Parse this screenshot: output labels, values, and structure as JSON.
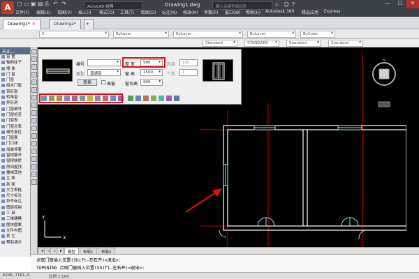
{
  "titlebar": {
    "app_icon": "A",
    "workspace": "AutoCAD 经典",
    "title": "Drawing1.dwg",
    "search_placeholder": "键入关键字或短语",
    "menu": [
      "文件(F)",
      "编辑(E)",
      "视图(V)",
      "插入(I)",
      "格式(O)",
      "工具(T)",
      "绘图(D)",
      "标注(N)",
      "修改(M)",
      "参数(P)",
      "窗口(W)",
      "帮助(H)",
      "Autodesk 360",
      "精选应用",
      "Express"
    ],
    "min": "—",
    "max": "☐",
    "close": "✕"
  },
  "doc_tabs": [
    {
      "label": "Drawing1*",
      "active": true
    },
    {
      "label": "Drawing2*",
      "active": false
    }
  ],
  "props": {
    "layer": "0",
    "color": "ByLayer",
    "linetype": "ByLayer",
    "lineweight": "ByLayer",
    "plotstyle": "ByColor",
    "textstyle": "Standard",
    "dimstyle": "STANDARD",
    "tablestyle": "Standard",
    "mleaderstyle": "Standard",
    "row2_workspace": "AutoCAD 经典"
  },
  "left_panel": {
    "header": "天正...",
    "items": [
      "设  置",
      "轴网柱子",
      "墙  体",
      "门  窗",
      "门窗",
      "组合门窗",
      "带形窗",
      "转角窗",
      "异形洞",
      "门窗编号",
      "门窗检查",
      "门窗表",
      "门窗总表",
      "编号复位",
      "门窗套",
      "门口线",
      "加装饰套",
      "窗棂展开",
      "窗棂映射",
      "房间屋顶",
      "楼梯其他",
      "立  面",
      "剖  面",
      "文字表格",
      "尺寸标注",
      "符号标注",
      "图层控制",
      "工  具",
      "三维建模",
      "图块图案",
      "文件布图",
      "其  它",
      "帮助演示"
    ]
  },
  "dialog": {
    "number_label": "编号",
    "number_value": "",
    "type_label": "类型",
    "type_value": "普通窗",
    "lookup_btn": "查表",
    "highwindow_label": "高窗",
    "width_label": "窗  宽",
    "width_value": "980",
    "height_label": "窗  高",
    "height_value": "1500",
    "sill_label": "窗台高",
    "sill_value": "900",
    "distance_label": "距离",
    "distance_value": "100",
    "count_label": "个数",
    "count_value": "1"
  },
  "bottom_tabs": [
    {
      "label": "模型",
      "active": true
    },
    {
      "label": "布局1",
      "active": false
    },
    {
      "label": "布局2",
      "active": false
    }
  ],
  "command": {
    "line1": "点取门窗插入位置(Shift-左右开)<退出>:",
    "line2": "TOPENING 点取门窗插入位置(Shift-左右开)<退出>:"
  },
  "status": {
    "coords": "6245, 7161, 0",
    "scale": "比例 1:100"
  },
  "colors": {
    "highlight": "#e01010",
    "canvas": "#000000",
    "wall": "#ffffff",
    "axis": "#c00000",
    "door": "#8fe3e8"
  }
}
